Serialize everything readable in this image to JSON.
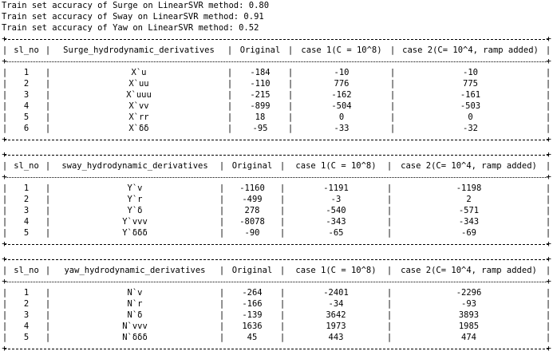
{
  "accuracy_lines": [
    "Train set accuracy of Surge on LinearSVR method: 0.80",
    "Train set accuracy of Sway on LinearSVR method: 0.91",
    "Train set accuracy of Yaw on LinearSVR method: 0.52"
  ],
  "tables": [
    {
      "headers": [
        "sl_no",
        "Surge_hydrodynamic_derivatives",
        "Original",
        "case 1(C = 10^8)",
        "case 2(C= 10^4, ramp added)"
      ],
      "rows": [
        [
          "1",
          "X`u",
          "-184",
          "-10",
          "-10"
        ],
        [
          "2",
          "X`uu",
          "-110",
          "776",
          "775"
        ],
        [
          "3",
          "X`uuu",
          "-215",
          "-162",
          "-161"
        ],
        [
          "4",
          "X`vv",
          "-899",
          "-504",
          "-503"
        ],
        [
          "5",
          "X`rr",
          "18",
          "0",
          "0"
        ],
        [
          "6",
          "X`δδ",
          "-95",
          "-33",
          "-32"
        ]
      ]
    },
    {
      "headers": [
        "sl_no",
        "sway_hydrodynamic_derivatives",
        "Original",
        "case 1(C = 10^8)",
        "case 2(C= 10^4, ramp added)"
      ],
      "rows": [
        [
          "1",
          "Y`v",
          "-1160",
          "-1191",
          "-1198"
        ],
        [
          "2",
          "Y`r",
          "-499",
          "-3",
          "2"
        ],
        [
          "3",
          "Y`δ",
          "278",
          "-540",
          "-571"
        ],
        [
          "4",
          "Y`vvv",
          "-8078",
          "-343",
          "-343"
        ],
        [
          "5",
          "Y`δδδ",
          "-90",
          "-65",
          "-69"
        ]
      ]
    },
    {
      "headers": [
        "sl_no",
        "yaw_hydrodynamic_derivatives",
        "Original",
        "case 1(C = 10^8)",
        "case 2(C= 10^4, ramp added)"
      ],
      "rows": [
        [
          "1",
          "N`v",
          "-264",
          "-2401",
          "-2296"
        ],
        [
          "2",
          "N`r",
          "-166",
          "-34",
          "-93"
        ],
        [
          "3",
          "N`δ",
          "-139",
          "3642",
          "3893"
        ],
        [
          "4",
          "N`vvv",
          "1636",
          "1973",
          "1985"
        ],
        [
          "5",
          "N`δδδ",
          "45",
          "443",
          "474"
        ]
      ]
    }
  ]
}
